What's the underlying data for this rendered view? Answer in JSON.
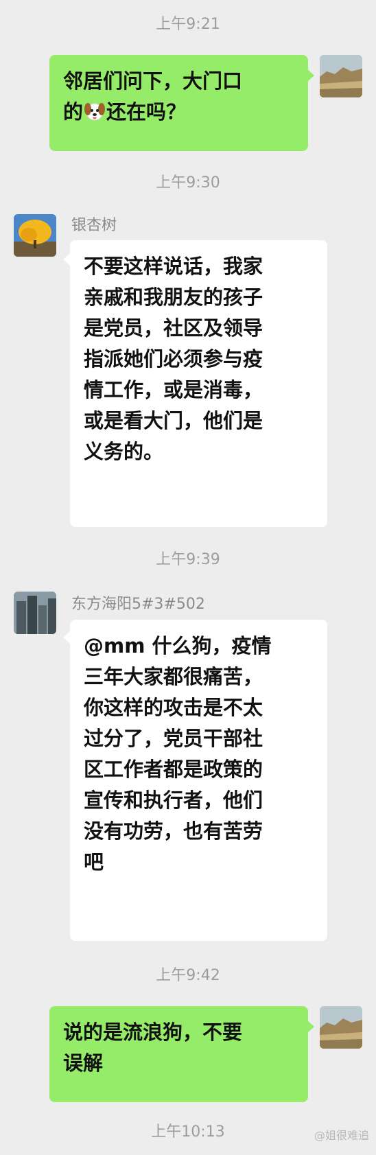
{
  "messages": {
    "ts1": "上午9:21",
    "m1_line1": "邻居们问下，大门口",
    "m1_line2a": "的",
    "m1_line2b": "还在吗？",
    "ts2": "上午9:30",
    "name2": "银杏树",
    "m2_lines": [
      "不要这样说话，我家",
      "亲戚和我朋友的孩子",
      "是党员，社区及领导",
      "指派她们必须参与疫",
      "情工作，或是消毒，",
      "或是看大门，他们是",
      "义务的。"
    ],
    "ts3": "上午9:39",
    "name3": "东方海阳5#3#502",
    "m3_lines": [
      "@mm 什么狗，疫情",
      "三年大家都很痛苦，",
      "你这样的攻击是不太",
      "过分了，党员干部社",
      "区工作者都是政策的",
      "宣传和执行者，他们",
      "没有功劳，也有苦劳",
      "吧"
    ],
    "ts4": "上午9:42",
    "m4_lines": [
      "说的是流浪狗，不要",
      "误解"
    ],
    "ts5": "上午10:13",
    "watermark": "@姐很难追"
  },
  "icons": {
    "dog": "dog-face-emoji",
    "self_avatar": "desert-landscape-avatar",
    "ginkgo_avatar": "ginkgo-tree-avatar",
    "building_avatar": "city-buildings-avatar"
  },
  "colors": {
    "background": "#ededed",
    "mine_bubble": "#95ec69",
    "theirs_bubble": "#ffffff",
    "timestamp": "#9c9c9c"
  }
}
